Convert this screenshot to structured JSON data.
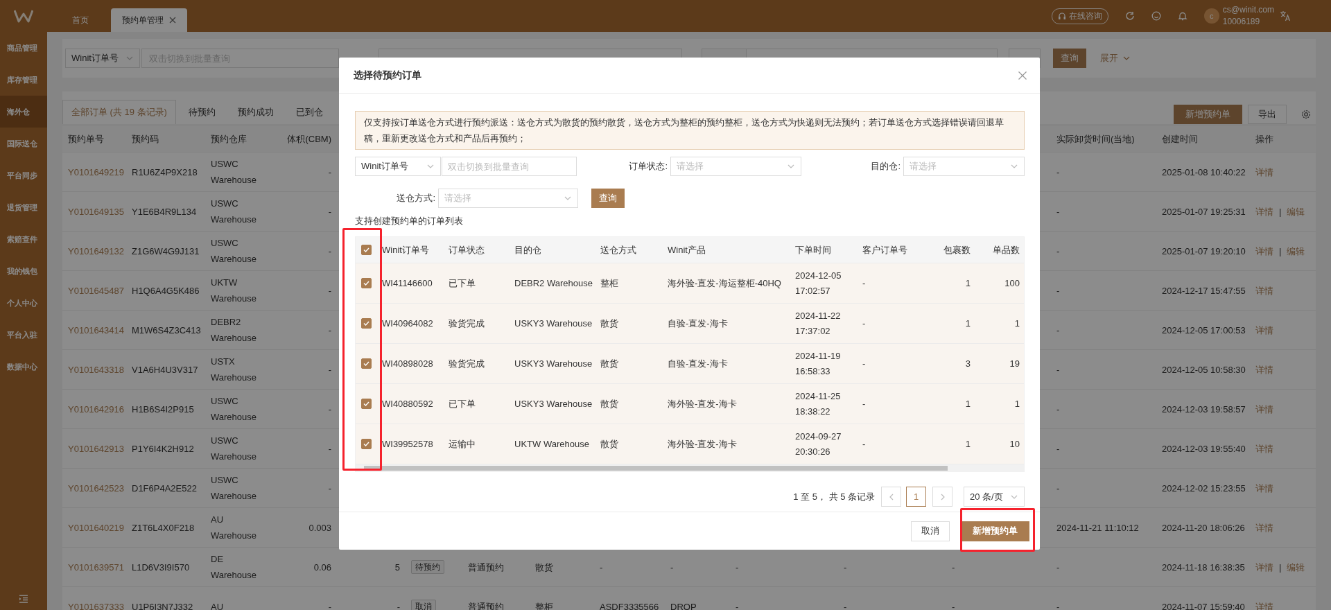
{
  "topbar": {
    "tabs": [
      {
        "label": "首页",
        "selected": false,
        "closable": false
      },
      {
        "label": "预约单管理",
        "selected": true,
        "closable": true
      }
    ],
    "consult_button": "在线咨询",
    "user": {
      "avatar": "c",
      "email": "cs@winit.com",
      "account": "10006189"
    }
  },
  "sidebar": {
    "items": [
      {
        "label": "商品管理",
        "selected": false
      },
      {
        "label": "库存管理",
        "selected": false
      },
      {
        "label": "海外仓",
        "selected": true
      },
      {
        "label": "国际送仓",
        "selected": false
      },
      {
        "label": "平台同步",
        "selected": false
      },
      {
        "label": "退货管理",
        "selected": false
      },
      {
        "label": "索赔查件",
        "selected": false
      },
      {
        "label": "我的钱包",
        "selected": false
      },
      {
        "label": "个人中心",
        "selected": false
      },
      {
        "label": "平台入驻",
        "selected": false
      },
      {
        "label": "数据中心",
        "selected": false
      }
    ]
  },
  "filter_bar": {
    "search_type": "Winit订单号",
    "search_placeholder": "双击切换到批量查询",
    "query_button": "查询",
    "expand_button": "展开"
  },
  "status_tabs": {
    "tabs": [
      {
        "label": "全部订单 (共 19 条记录)",
        "selected": true
      },
      {
        "label": "待预约",
        "selected": false
      },
      {
        "label": "预约成功",
        "selected": false
      },
      {
        "label": "已到仓",
        "selected": false
      }
    ],
    "new_button": "新增预约单",
    "export_button": "导出"
  },
  "table": {
    "left_columns": [
      "预约单号",
      "预约码",
      "预约仓库",
      "体积(CBM)"
    ],
    "right_columns": [
      "实际卸货时间(当地)",
      "创建时间",
      "操作"
    ],
    "action_separator": "|",
    "rows": [
      {
        "id": "Y0101649219",
        "code": "R1U6Z4P9X218",
        "warehouse": "USWC Warehouse",
        "volume": "-",
        "unload_time": "-",
        "created": "2025-01-08 10:40:22",
        "actions": [
          "详情"
        ]
      },
      {
        "id": "Y0101649135",
        "code": "Y1E6B4R9L134",
        "warehouse": "USWC Warehouse",
        "volume": "-",
        "unload_time": "-",
        "created": "2025-01-07 19:25:31",
        "actions": [
          "详情",
          "编辑"
        ]
      },
      {
        "id": "Y0101649132",
        "code": "Z1G6W4G9J131",
        "warehouse": "USWC Warehouse",
        "volume": "-",
        "unload_time": "-",
        "created": "2025-01-07 19:20:10",
        "actions": [
          "详情",
          "编辑"
        ]
      },
      {
        "id": "Y0101645487",
        "code": "H1Q6A4G5K486",
        "warehouse": "UKTW Warehouse",
        "volume": "-",
        "unload_time": "-",
        "created": "2024-12-17 15:47:55",
        "actions": [
          "详情"
        ]
      },
      {
        "id": "Y0101643414",
        "code": "M1W6S4Z3C413",
        "warehouse": "DEBR2 Warehouse",
        "volume": "-",
        "unload_time": "-",
        "created": "2024-12-05 17:00:53",
        "actions": [
          "详情"
        ]
      },
      {
        "id": "Y0101643318",
        "code": "V1A6H4U3V317",
        "warehouse": "USTX Warehouse",
        "volume": "-",
        "unload_time": "-",
        "created": "2024-12-05 10:58:30",
        "actions": [
          "详情"
        ]
      },
      {
        "id": "Y0101642916",
        "code": "H1B6S4I2P915",
        "warehouse": "USWC Warehouse",
        "volume": "-",
        "unload_time": "-",
        "created": "2024-12-03 19:58:57",
        "actions": [
          "详情"
        ]
      },
      {
        "id": "Y0101642913",
        "code": "P1Y6I4K2H912",
        "warehouse": "USWC Warehouse",
        "volume": "-",
        "unload_time": "-",
        "created": "2024-12-03 19:55:40",
        "actions": [
          "详情"
        ]
      },
      {
        "id": "Y0101642523",
        "code": "D1F6P4A2E522",
        "warehouse": "USWC Warehouse",
        "volume": "-",
        "unload_time": "-",
        "created": "2024-12-02 15:23:55",
        "actions": [
          "详情"
        ]
      },
      {
        "id": "Y0101640219",
        "code": "Z1T6L4X0F218",
        "warehouse": "AU Warehouse",
        "volume": "0.003",
        "unload_time": "2024-11-21 11:10:12",
        "created": "2024-11-20 18:06:26",
        "actions": [
          "详情"
        ]
      },
      {
        "id": "Y0101639571",
        "code": "L1D6V3I9I570",
        "warehouse": "DE Warehouse",
        "volume": "0.06",
        "middle": [
          {
            "kind": "number",
            "text": "5"
          },
          {
            "kind": "tag",
            "text": "待预约"
          },
          {
            "kind": "text",
            "text": "普通预约"
          },
          {
            "kind": "text",
            "text": "散货"
          },
          {
            "kind": "text",
            "text": "-"
          },
          {
            "kind": "text",
            "text": "-"
          },
          {
            "kind": "text",
            "text": "-"
          },
          {
            "kind": "text",
            "text": "-"
          },
          {
            "kind": "text",
            "text": "-"
          }
        ],
        "unload_time": "-",
        "created": "2024-11-18 16:38:35",
        "actions": [
          "详情",
          "编辑"
        ]
      },
      {
        "id": "Y0101637333",
        "code": "U1P6I3N7J332",
        "warehouse": "AU",
        "volume": "-",
        "middle": [
          {
            "kind": "number",
            "text": "-"
          },
          {
            "kind": "tag",
            "text": "取消"
          },
          {
            "kind": "text",
            "text": "普通预约"
          },
          {
            "kind": "text",
            "text": "整柜"
          },
          {
            "kind": "text",
            "text": "ASDF3335566"
          },
          {
            "kind": "text",
            "text": "DROP"
          },
          {
            "kind": "text",
            "text": "-"
          },
          {
            "kind": "text",
            "text": "-"
          },
          {
            "kind": "text",
            "text": "-"
          }
        ],
        "unload_time": "-",
        "created": "2024-11-07 15:59:40",
        "actions": [
          "详情"
        ]
      }
    ]
  },
  "modal": {
    "title": "选择待预约订单",
    "notice": "仅支持按订单送仓方式进行预约派送：送仓方式为散货的预约散货，送仓方式为整柜的预约整柜，送仓方式为快递则无法预约；若订单送仓方式选择错误请回退草稿，重新更改送仓方式和产品后再预约；",
    "filters": {
      "search_type": "Winit订单号",
      "search_placeholder": "双击切换到批量查询",
      "status_label": "订单状态:",
      "status_placeholder": "请选择",
      "warehouse_label": "目的仓:",
      "warehouse_placeholder": "请选择",
      "delivery_label": "送仓方式:",
      "delivery_placeholder": "请选择",
      "query_button": "查询"
    },
    "list_title": "支持创建预约单的订单列表",
    "table": {
      "all_checked": true,
      "columns": [
        "Winit订单号",
        "订单状态",
        "目的仓",
        "送仓方式",
        "Winit产品",
        "下单时间",
        "客户订单号",
        "包裹数",
        "单品数"
      ],
      "rows": [
        {
          "checked": true,
          "cells": [
            "WI41146600",
            "已下单",
            "DEBR2 Warehouse",
            "整柜",
            "海外验-直发-海运整柜-40HQ",
            "2024-12-05 17:02:57",
            "-",
            "1",
            "100"
          ]
        },
        {
          "checked": true,
          "cells": [
            "WI40964082",
            "验货完成",
            "USKY3 Warehouse",
            "散货",
            "自验-直发-海卡",
            "2024-11-22 17:37:02",
            "-",
            "1",
            "1"
          ]
        },
        {
          "checked": true,
          "cells": [
            "WI40898028",
            "验货完成",
            "USKY3 Warehouse",
            "散货",
            "自验-直发-海卡",
            "2024-11-19 16:58:33",
            "-",
            "3",
            "19"
          ]
        },
        {
          "checked": true,
          "cells": [
            "WI40880592",
            "已下单",
            "USKY3 Warehouse",
            "散货",
            "海外验-直发-海卡",
            "2024-11-25 18:38:22",
            "-",
            "1",
            "1"
          ]
        },
        {
          "checked": true,
          "cells": [
            "WI39952578",
            "运输中",
            "UKTW Warehouse",
            "散货",
            "海外验-直发-海卡",
            "2024-09-27 20:30:26",
            "-",
            "1",
            "10"
          ]
        }
      ]
    },
    "pagination": {
      "summary": "1 至 5， 共 5 条记录",
      "pages": [
        {
          "label": "1",
          "selected": true
        }
      ],
      "page_size": "20 条/页"
    },
    "buttons": {
      "cancel": "取消",
      "confirm": "新增预约单"
    }
  }
}
